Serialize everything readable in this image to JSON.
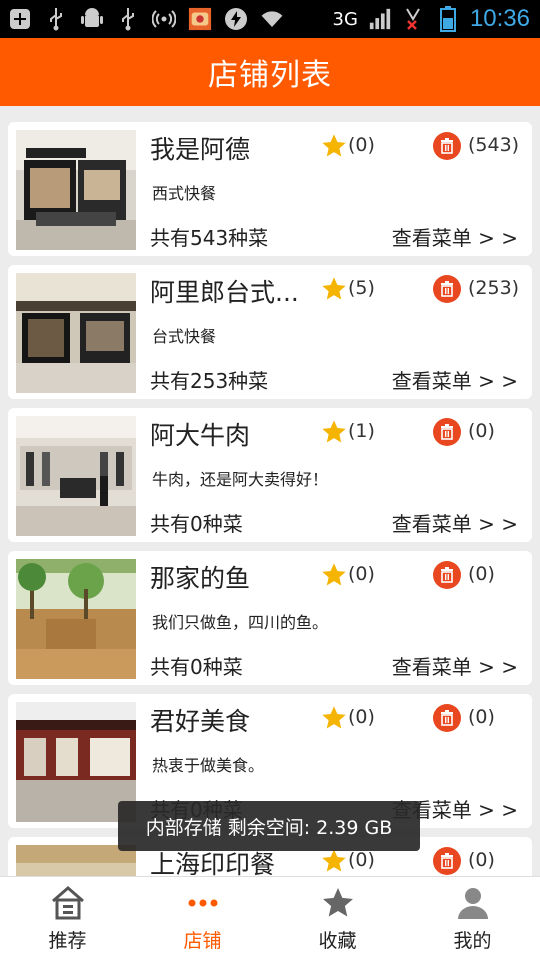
{
  "status_bar": {
    "network": "3G",
    "time": "10:36",
    "icons": [
      "add-icon",
      "usb-icon",
      "android-debug-icon",
      "usb-icon",
      "wireless-icon",
      "app-notification-icon",
      "lightning-icon",
      "wifi-icon",
      "signal-icon",
      "no-sim-icon",
      "battery-icon"
    ]
  },
  "title": "店铺列表",
  "shops": [
    {
      "name": "我是阿德",
      "favorites": "(0)",
      "menus": "(543)",
      "description": "西式快餐",
      "dish_count": "共有543种菜",
      "menu_link": "查看菜单 > >"
    },
    {
      "name": "阿里郎台式...",
      "favorites": "(5)",
      "menus": "(253)",
      "description": "台式快餐",
      "dish_count": "共有253种菜",
      "menu_link": "查看菜单 > >"
    },
    {
      "name": "阿大牛肉",
      "favorites": "(1)",
      "menus": "(0)",
      "description": "牛肉，还是阿大卖得好！",
      "dish_count": "共有0种菜",
      "menu_link": "查看菜单 > >"
    },
    {
      "name": "那家的鱼",
      "favorites": "(0)",
      "menus": "(0)",
      "description": "我们只做鱼，四川的鱼。",
      "dish_count": "共有0种菜",
      "menu_link": "查看菜单 > >"
    },
    {
      "name": "君好美食",
      "favorites": "(0)",
      "menus": "(0)",
      "description": "热衷于做美食。",
      "dish_count": "共有0种菜",
      "menu_link": "查看菜单 > >"
    },
    {
      "name": "上海印印餐",
      "favorites": "(0)",
      "menus": "(0)",
      "description": "",
      "dish_count": "",
      "menu_link": ""
    }
  ],
  "toast": "内部存储 剩余空间: 2.39 GB",
  "nav": [
    {
      "label": "推荐",
      "icon": "home-icon",
      "active": false
    },
    {
      "label": "店铺",
      "icon": "more-dots-icon",
      "active": true
    },
    {
      "label": "收藏",
      "icon": "star-icon",
      "active": false
    },
    {
      "label": "我的",
      "icon": "person-icon",
      "active": false
    }
  ],
  "colors": {
    "accent": "#ff5a00",
    "menu_icon": "#e8471f",
    "star": "#f5b400",
    "time": "#3fa9e6"
  }
}
